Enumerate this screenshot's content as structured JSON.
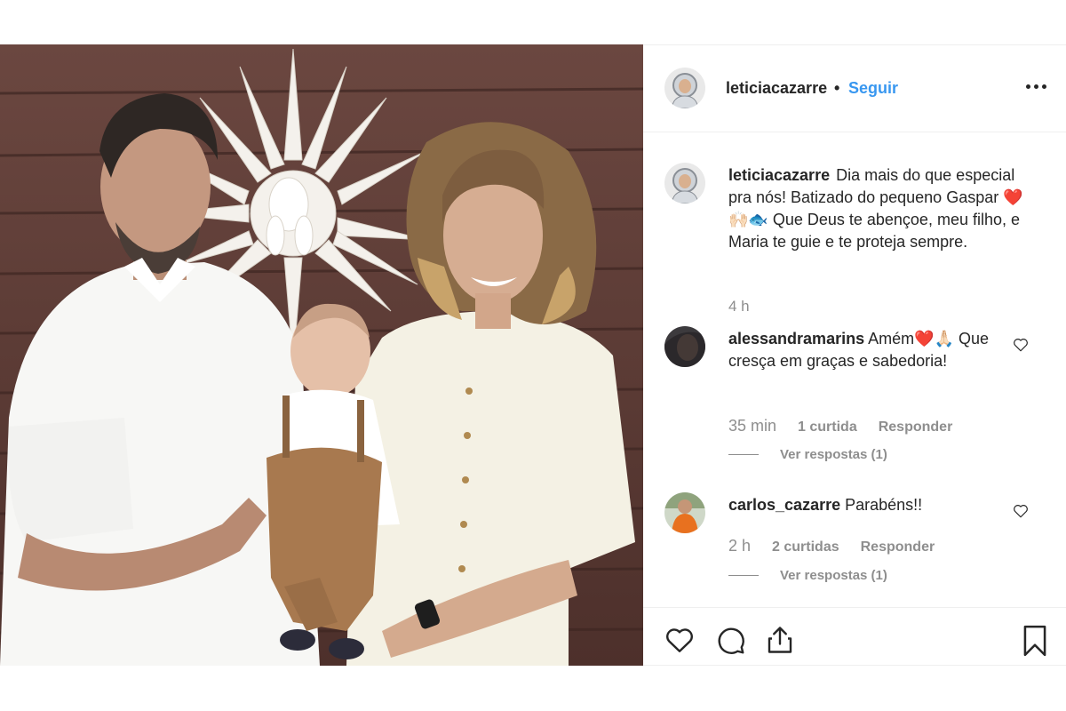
{
  "post": {
    "author": "leticiacazarre",
    "separator": "•",
    "follow_label": "Seguir",
    "caption_text": "Dia mais do que especial pra nós! Batizado do pequeno Gaspar ❤️🙌🏻🐟 Que Deus te abençoe, meu filho, e Maria te guie e te proteja sempre.",
    "time": "4 h"
  },
  "comments": [
    {
      "username": "alessandramarins",
      "text": "Amém❤️🙏🏻 Que cresça em graças e sabedoria!",
      "time": "35 min",
      "likes": "1 curtida",
      "reply_label": "Responder",
      "view_replies": "Ver respostas (1)"
    },
    {
      "username": "carlos_cazarre",
      "text": "Parabéns!!",
      "time": "2 h",
      "likes": "2 curtidas",
      "reply_label": "Responder",
      "view_replies": "Ver respostas (1)"
    }
  ],
  "icons": {
    "more": "more-horizontal-icon",
    "like": "heart-icon",
    "comment": "comment-icon",
    "share": "share-icon",
    "save": "bookmark-icon"
  },
  "colors": {
    "link": "#3897f0",
    "text": "#262626",
    "muted": "#8e8e8e",
    "border": "#efefef"
  }
}
